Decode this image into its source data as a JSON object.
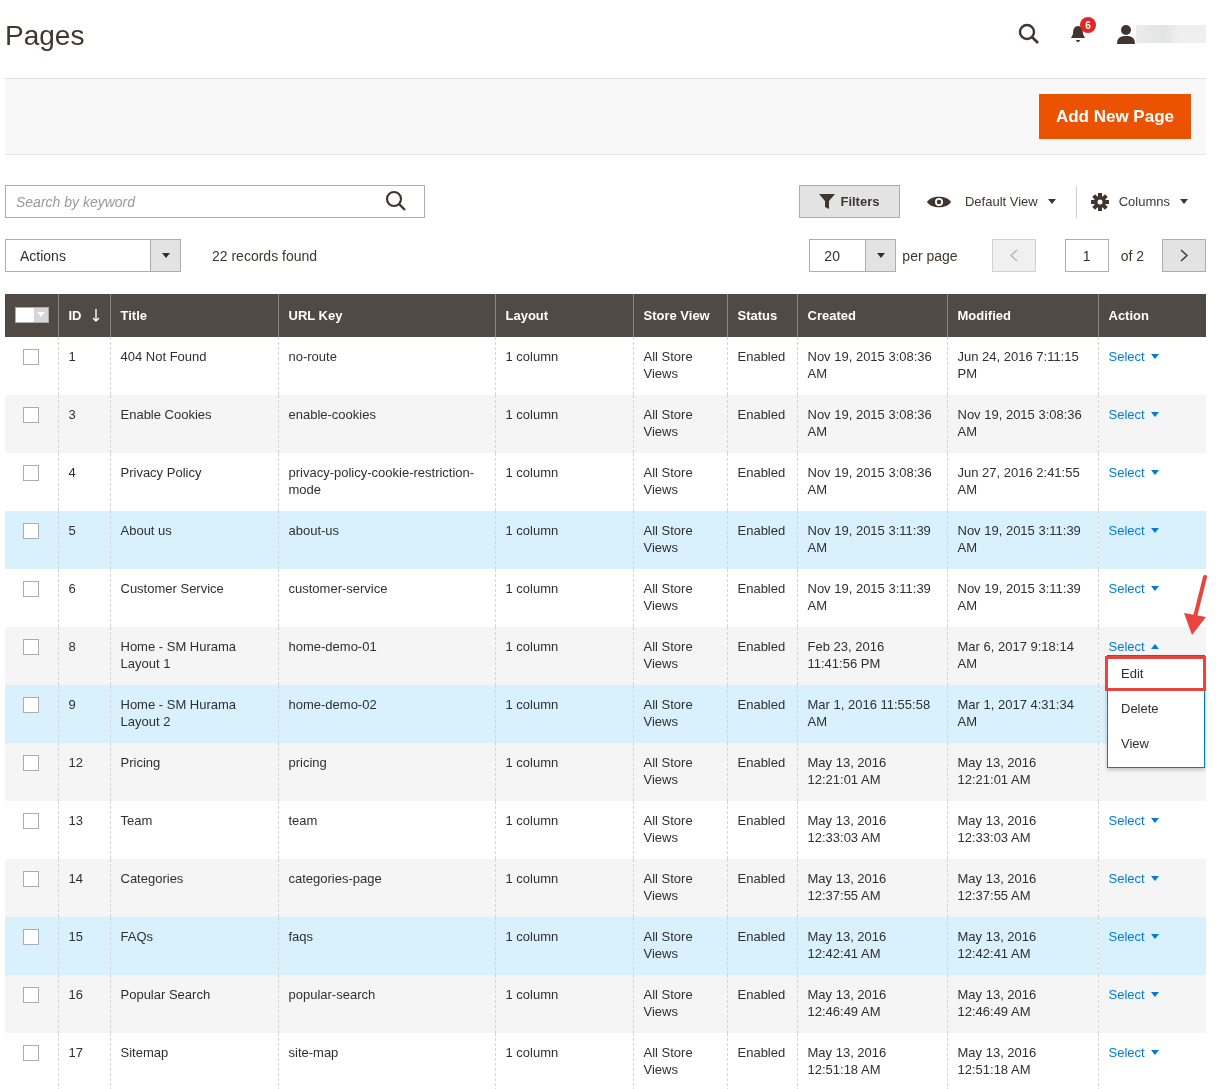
{
  "header": {
    "title": "Pages",
    "notification_count": "6"
  },
  "add_button": "Add New Page",
  "search": {
    "placeholder": "Search by keyword"
  },
  "toolbar": {
    "filters": "Filters",
    "view": "Default View",
    "columns": "Columns"
  },
  "actions": {
    "label": "Actions",
    "records": "22 records found"
  },
  "pager": {
    "per_page_value": "20",
    "per_page_label": "per page",
    "page": "1",
    "of": "of 2"
  },
  "table": {
    "columns": [
      {
        "label": "ID",
        "sorted": true
      },
      {
        "label": "Title",
        "sorted": false
      },
      {
        "label": "URL Key",
        "sorted": false
      },
      {
        "label": "Layout",
        "sorted": false
      },
      {
        "label": "Store View",
        "sorted": false
      },
      {
        "label": "Status",
        "sorted": false
      },
      {
        "label": "Created",
        "sorted": false
      },
      {
        "label": "Modified",
        "sorted": false
      },
      {
        "label": "Action",
        "sorted": false
      }
    ],
    "rows": [
      {
        "id": "1",
        "title": "404 Not Found",
        "url_key": "no-route",
        "layout": "1 column",
        "store_view": "All Store Views",
        "status": "Enabled",
        "created": "Nov 19, 2015 3:08:36 AM",
        "modified": "Jun 24, 2016 7:11:15 PM",
        "action": "Select",
        "checked": false,
        "highlighted": false
      },
      {
        "id": "3",
        "title": "Enable Cookies",
        "url_key": "enable-cookies",
        "layout": "1 column",
        "store_view": "All Store Views",
        "status": "Enabled",
        "created": "Nov 19, 2015 3:08:36 AM",
        "modified": "Nov 19, 2015 3:08:36 AM",
        "action": "Select",
        "checked": false,
        "highlighted": false
      },
      {
        "id": "4",
        "title": "Privacy Policy",
        "url_key": "privacy-policy-cookie-restriction-mode",
        "layout": "1 column",
        "store_view": "All Store Views",
        "status": "Enabled",
        "created": "Nov 19, 2015 3:08:36 AM",
        "modified": "Jun 27, 2016 2:41:55 AM",
        "action": "Select",
        "checked": false,
        "highlighted": false
      },
      {
        "id": "5",
        "title": "About us",
        "url_key": "about-us",
        "layout": "1 column",
        "store_view": "All Store Views",
        "status": "Enabled",
        "created": "Nov 19, 2015 3:11:39 AM",
        "modified": "Nov 19, 2015 3:11:39 AM",
        "action": "Select",
        "checked": false,
        "highlighted": true
      },
      {
        "id": "6",
        "title": "Customer Service",
        "url_key": "customer-service",
        "layout": "1 column",
        "store_view": "All Store Views",
        "status": "Enabled",
        "created": "Nov 19, 2015 3:11:39 AM",
        "modified": "Nov 19, 2015 3:11:39 AM",
        "action": "Select",
        "checked": false,
        "highlighted": false
      },
      {
        "id": "8",
        "title": "Home - SM Hurama Layout 1",
        "url_key": "home-demo-01",
        "layout": "1 column",
        "store_view": "All Store Views",
        "status": "Enabled",
        "created": "Feb 23, 2016 11:41:56 PM",
        "modified": "Mar 6, 2017 9:18:14 AM",
        "action": "Select",
        "checked": false,
        "highlighted": false,
        "menu": [
          {
            "label": "Edit",
            "marked": true
          },
          {
            "label": "Delete",
            "marked": false
          },
          {
            "label": "View",
            "marked": false
          }
        ]
      },
      {
        "id": "9",
        "title": "Home - SM Hurama Layout 2",
        "url_key": "home-demo-02",
        "layout": "1 column",
        "store_view": "All Store Views",
        "status": "Enabled",
        "created": "Mar 1, 2016 11:55:58 AM",
        "modified": "Mar 1, 2017 4:31:34 AM",
        "checked": false,
        "highlighted": true
      },
      {
        "id": "12",
        "title": "Pricing",
        "url_key": "pricing",
        "layout": "1 column",
        "store_view": "All Store Views",
        "status": "Enabled",
        "created": "May 13, 2016 12:21:01 AM",
        "modified": "May 13, 2016 12:21:01 AM",
        "checked": false,
        "highlighted": false
      },
      {
        "id": "13",
        "title": "Team",
        "url_key": "team",
        "layout": "1 column",
        "store_view": "All Store Views",
        "status": "Enabled",
        "created": "May 13, 2016 12:33:03 AM",
        "modified": "May 13, 2016 12:33:03 AM",
        "action": "Select",
        "checked": false,
        "highlighted": false
      },
      {
        "id": "14",
        "title": "Categories",
        "url_key": "categories-page",
        "layout": "1 column",
        "store_view": "All Store Views",
        "status": "Enabled",
        "created": "May 13, 2016 12:37:55 AM",
        "modified": "May 13, 2016 12:37:55 AM",
        "action": "Select",
        "checked": false,
        "highlighted": false
      },
      {
        "id": "15",
        "title": "FAQs",
        "url_key": "faqs",
        "layout": "1 column",
        "store_view": "All Store Views",
        "status": "Enabled",
        "created": "May 13, 2016 12:42:41 AM",
        "modified": "May 13, 2016 12:42:41 AM",
        "action": "Select",
        "checked": false,
        "highlighted": true
      },
      {
        "id": "16",
        "title": "Popular Search",
        "url_key": "popular-search",
        "layout": "1 column",
        "store_view": "All Store Views",
        "status": "Enabled",
        "created": "May 13, 2016 12:46:49 AM",
        "modified": "May 13, 2016 12:46:49 AM",
        "action": "Select",
        "checked": false,
        "highlighted": false
      },
      {
        "id": "17",
        "title": "Sitemap",
        "url_key": "site-map",
        "layout": "1 column",
        "store_view": "All Store Views",
        "status": "Enabled",
        "created": "May 13, 2016 12:51:18 AM",
        "modified": "May 13, 2016 12:51:18 AM",
        "action": "Select",
        "checked": false,
        "highlighted": false
      }
    ]
  }
}
